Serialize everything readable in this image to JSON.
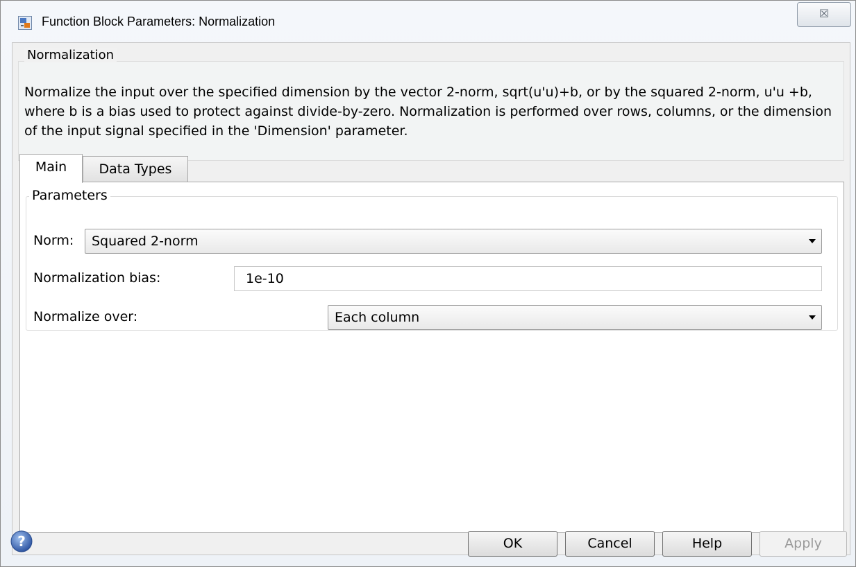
{
  "window": {
    "title": "Function Block Parameters: Normalization",
    "close_glyph": "☒"
  },
  "description": {
    "group_title": "Normalization",
    "text": "Normalize the input over the specified dimension by the vector 2-norm, sqrt(u'u)+b, or by the squared 2-norm, u'u +b, where b is a bias used to protect against divide-by-zero.  Normalization is performed over rows, columns, or the dimension of the input signal specified in the 'Dimension' parameter."
  },
  "tabs": [
    {
      "label": "Main",
      "active": true
    },
    {
      "label": "Data Types",
      "active": false
    }
  ],
  "parameters": {
    "group_title": "Parameters",
    "norm": {
      "label": "Norm:",
      "value": "Squared 2-norm"
    },
    "bias": {
      "label": "Normalization bias:",
      "value": "1e-10"
    },
    "normalize_over": {
      "label": "Normalize over:",
      "value": "Each column"
    }
  },
  "buttons": {
    "ok": "OK",
    "cancel": "Cancel",
    "help": "Help",
    "apply": "Apply",
    "apply_enabled": false
  },
  "icons": {
    "app": "simulink-block-icon",
    "help": "help-question-icon"
  },
  "colors": {
    "help_icon": "#3a5fa8",
    "disabled_text": "#9a9a9a"
  }
}
